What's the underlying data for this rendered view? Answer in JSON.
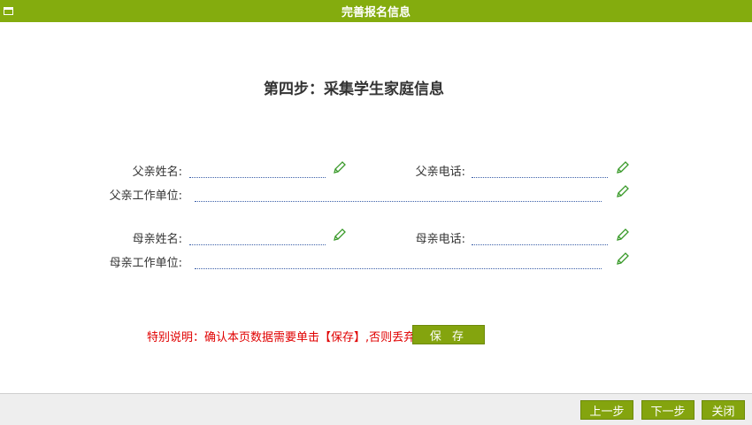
{
  "window": {
    "title": "完善报名信息"
  },
  "step_title": "第四步：采集学生家庭信息",
  "form": {
    "father_name_label": "父亲姓名:",
    "father_phone_label": "父亲电话:",
    "father_work_label": "父亲工作单位:",
    "mother_name_label": "母亲姓名:",
    "mother_phone_label": "母亲电话:",
    "mother_work_label": "母亲工作单位:",
    "father_name_value": "",
    "father_phone_value": "",
    "father_work_value": "",
    "mother_name_value": "",
    "mother_phone_value": "",
    "mother_work_value": ""
  },
  "notice": "特别说明：确认本页数据需要单击【保存】,否则丢弃⇒",
  "save_label": "保 存",
  "footer": {
    "prev_label": "上一步",
    "next_label": "下一步",
    "close_label": "关闭"
  },
  "colors": {
    "accent": "#84ac0e",
    "notice": "#e00000",
    "field_border": "#3b5fa8"
  },
  "icons": {
    "edit": "pencil-icon",
    "window": "window-icon"
  }
}
